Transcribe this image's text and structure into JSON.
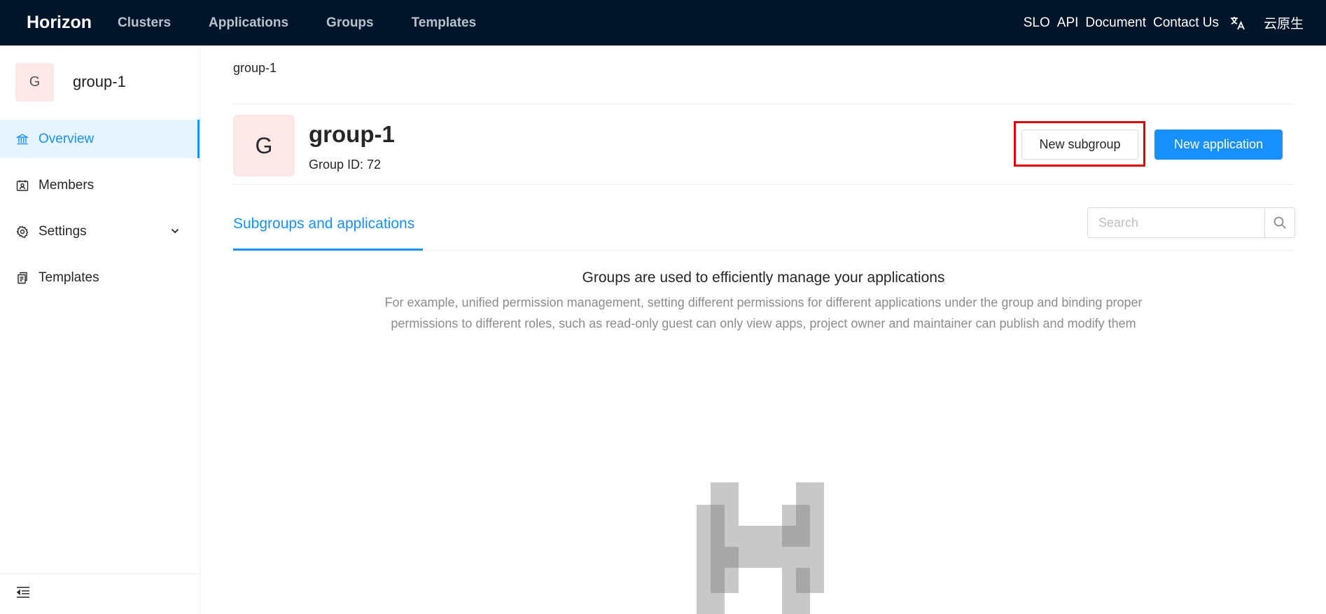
{
  "topbar": {
    "brand": "Horizon",
    "nav": [
      "Clusters",
      "Applications",
      "Groups",
      "Templates"
    ],
    "right_links": [
      "SLO",
      "API",
      "Document",
      "Contact Us"
    ],
    "translate_icon": "translate-icon",
    "user": "云原生"
  },
  "sidebar": {
    "avatar_letter": "G",
    "group_name": "group-1",
    "menu": [
      {
        "label": "Overview",
        "icon": "bank-icon",
        "active": true
      },
      {
        "label": "Members",
        "icon": "contacts-icon"
      },
      {
        "label": "Settings",
        "icon": "gear-icon"
      },
      {
        "label": "Templates",
        "icon": "snippets-icon"
      }
    ],
    "collapse_icon": "menu-fold-icon"
  },
  "main": {
    "breadcrumb": "group-1",
    "avatar_letter": "G",
    "title": "group-1",
    "group_id": "Group ID: 72",
    "new_subgroup": "New subgroup",
    "new_application": "New application",
    "tab": "Subgroups and applications",
    "search_placeholder": "Search",
    "empty_title": "Groups are used to efficiently manage your applications",
    "empty_desc": "For example, unified permission management, setting different permissions for different applications under the group and binding proper permissions to different roles, such as read-only guest can only view apps, project owner and maintainer can publish and modify them"
  },
  "colors": {
    "topbar": "#001529",
    "primary": "#1890ff",
    "avatar_bg": "#fde8e8",
    "highlight": "#e00000"
  }
}
